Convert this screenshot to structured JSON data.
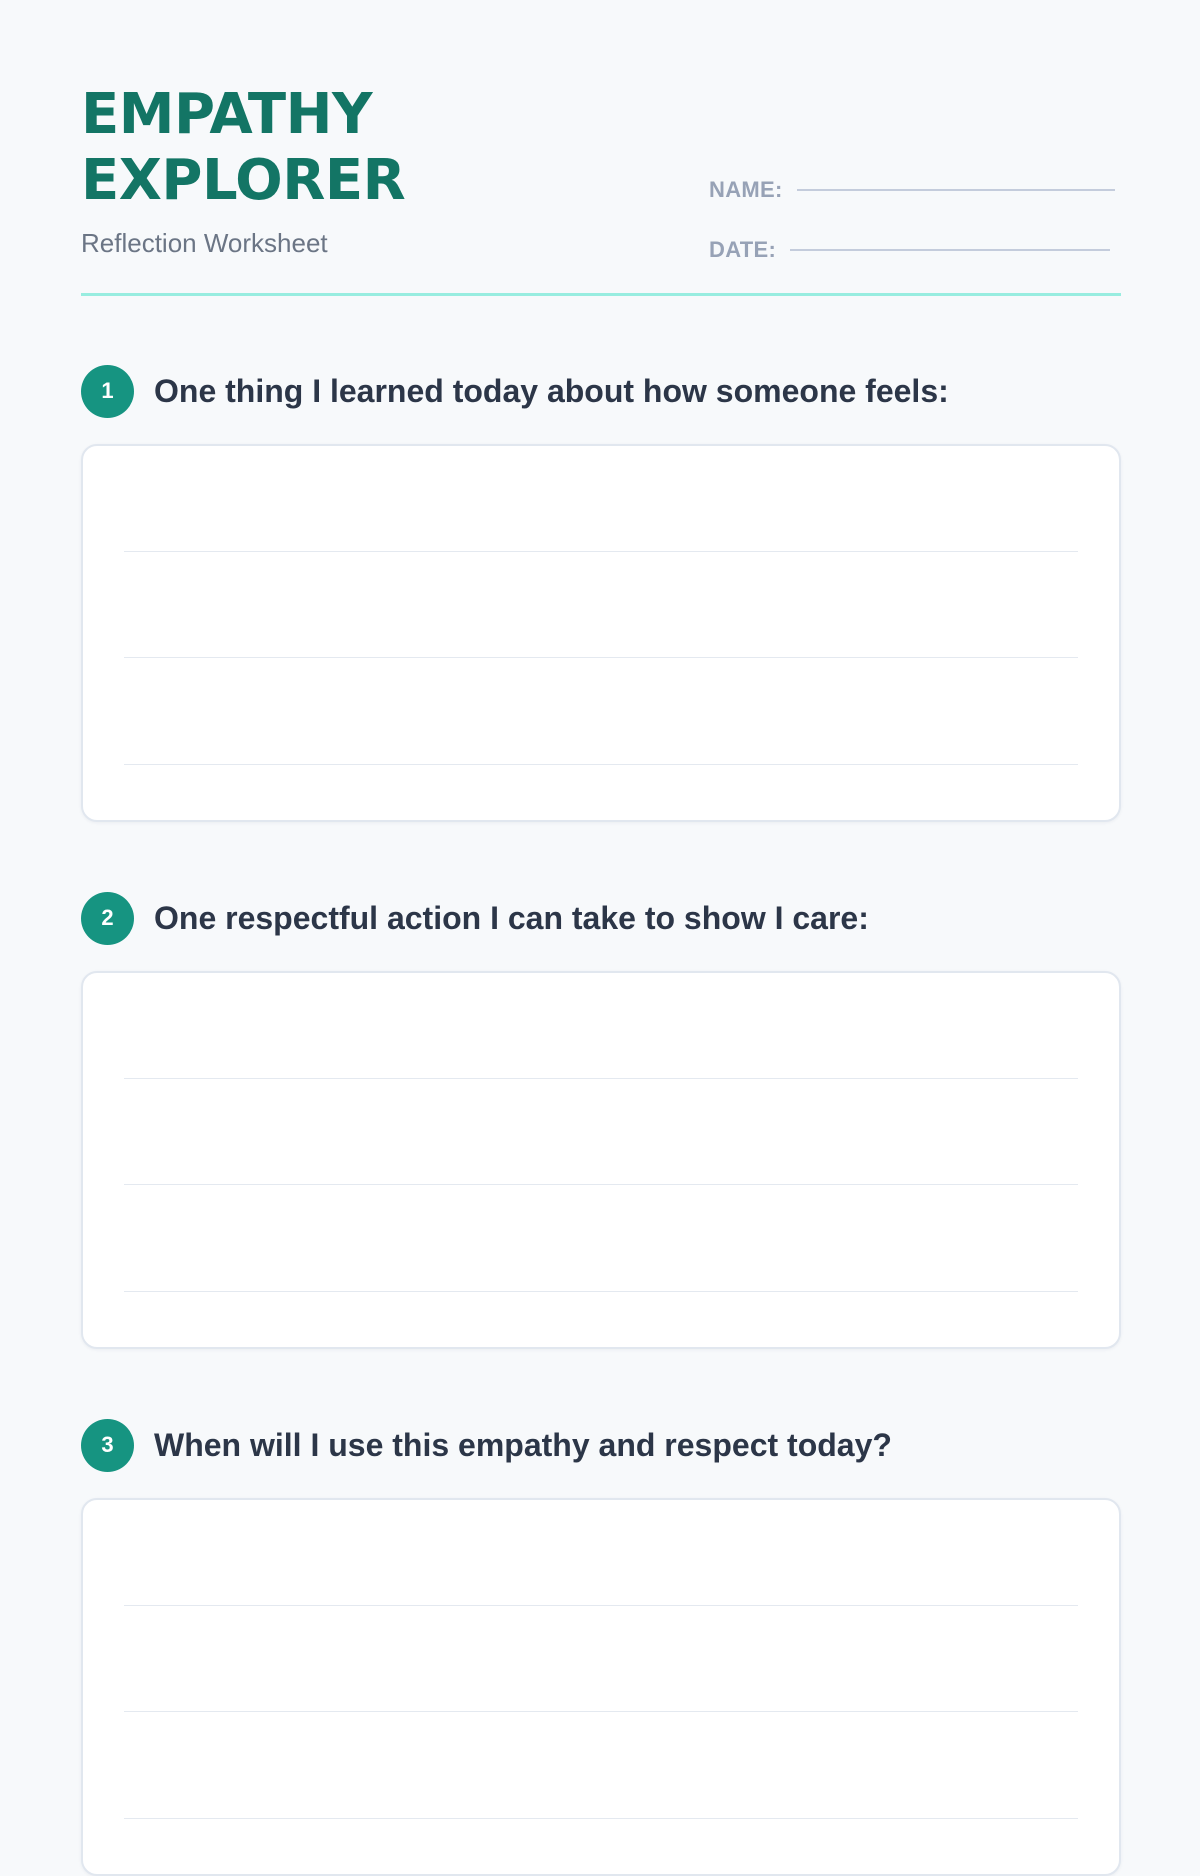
{
  "worksheet": {
    "title": "EMPATHY EXPLORER",
    "subtitle": "Reflection Worksheet",
    "fields": {
      "name_label": "NAME:",
      "date_label": "DATE:"
    }
  },
  "questions": [
    {
      "number": "1",
      "text": "One thing I learned today about how someone feels:"
    },
    {
      "number": "2",
      "text": "One respectful action I can take to show I care:"
    },
    {
      "number": "3",
      "text": "When will I use this empathy and respect today?"
    }
  ],
  "colors": {
    "accent": "#137565",
    "badge": "#169481",
    "rule": "#98ede0",
    "background": "#f7f9fb"
  }
}
